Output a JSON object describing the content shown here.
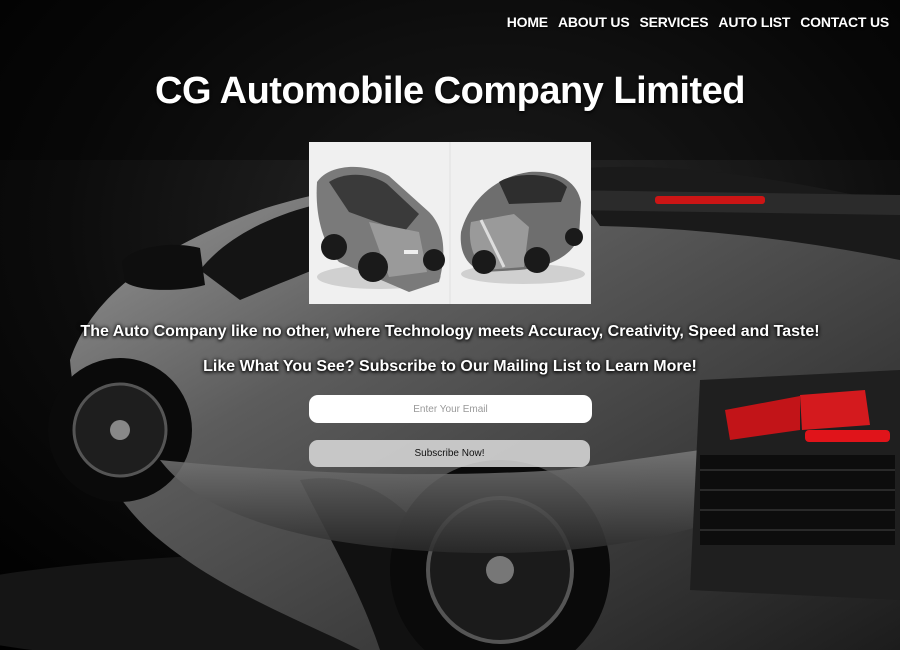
{
  "nav": {
    "items": [
      {
        "label": "HOME"
      },
      {
        "label": "ABOUT US"
      },
      {
        "label": "SERVICES"
      },
      {
        "label": "AUTO LIST"
      },
      {
        "label": "CONTACT US"
      }
    ]
  },
  "hero": {
    "title": "CG Automobile Company Limited",
    "tagline": "The Auto Company like no other, where Technology meets Accuracy, Creativity, Speed and Taste!",
    "cta": "Like What You See? Subscribe to Our Mailing List to Learn More!"
  },
  "subscribe": {
    "email_placeholder": "Enter Your Email",
    "email_value": "",
    "button_label": "Subscribe Now!"
  },
  "colors": {
    "background": "#000000",
    "text": "#ffffff",
    "taillight": "#e0141a"
  }
}
